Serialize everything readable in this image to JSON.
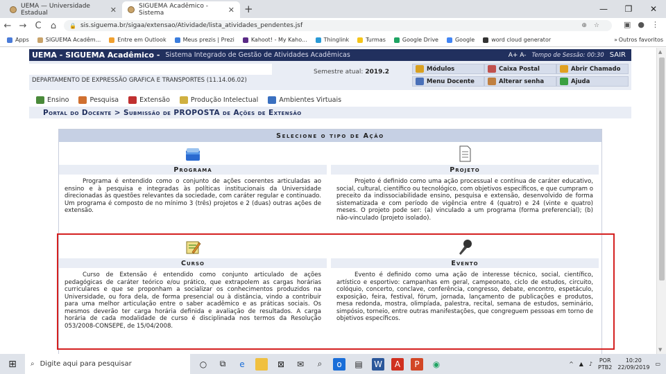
{
  "browser": {
    "tabs": [
      {
        "label": "UEMA — Universidade Estadual",
        "active": false
      },
      {
        "label": "SIGUEMA Acadêmico - Sistema",
        "active": true
      }
    ],
    "new_tab": "+",
    "window_controls": [
      "—",
      "❐",
      "✕"
    ],
    "url": "sis.siguema.br/sigaa/extensao/Atividade/lista_atividades_pendentes.jsf",
    "bookmarks": [
      {
        "label": "Apps",
        "color": "#4a7bd8"
      },
      {
        "label": "SIGUEMA Acadêm...",
        "color": "#c9a36a"
      },
      {
        "label": "Entre em Outlook",
        "color": "#f0a030"
      },
      {
        "label": "Meus prezis | Prezi",
        "color": "#3b7ddd"
      },
      {
        "label": "Kahoot! - My Kaho...",
        "color": "#5a2a86"
      },
      {
        "label": "Thinglink",
        "color": "#2a9ad6"
      },
      {
        "label": "Turmas",
        "color": "#f5c51a"
      },
      {
        "label": "Google Drive",
        "color": "#1fa463"
      },
      {
        "label": "Google",
        "color": "#4285f4"
      },
      {
        "label": "word cloud generator",
        "color": "#333333"
      }
    ],
    "bookmarks_more": "»",
    "bookmarks_other": "Outros favoritos"
  },
  "header": {
    "system_name": "UEMA - SIGUEMA Acadêmico -",
    "subtitle": "Sistema Integrado de Gestão de Atividades Acadêmicas",
    "font_controls": "A+  A-",
    "session": "Tempo de Sessão: 00:30",
    "logout": "SAIR"
  },
  "info": {
    "department": "DEPARTAMENTO DE EXPRESSÃO GRAFICA E TRANSPORTES (11.14.06.02)",
    "semester_label": "Semestre atual:",
    "semester_value": "2019.2",
    "links": [
      {
        "label": "Módulos",
        "color": "#d9a020"
      },
      {
        "label": "Caixa Postal",
        "color": "#c0504d"
      },
      {
        "label": "Abrir Chamado",
        "color": "#e0a020"
      },
      {
        "label": "Menu Docente",
        "color": "#4a70b8"
      },
      {
        "label": "Alterar senha",
        "color": "#c08040"
      },
      {
        "label": "Ajuda",
        "color": "#3aa040"
      }
    ]
  },
  "modules": [
    {
      "label": "Ensino",
      "color": "#4a8a3a"
    },
    {
      "label": "Pesquisa",
      "color": "#d07030"
    },
    {
      "label": "Extensão",
      "color": "#c03030"
    },
    {
      "label": "Produção Intelectual",
      "color": "#d0b040"
    },
    {
      "label": "Ambientes Virtuais",
      "color": "#3a70c0"
    }
  ],
  "breadcrumb": "Portal do Docente > Submissão de PROPOSTA de Ações de Extensão",
  "panel": {
    "heading": "Selecione o tipo de Ação",
    "actions": [
      {
        "title": "Programa",
        "icon": "folder-icon",
        "description": "Programa é entendido como o conjunto de ações coerentes articuladas ao ensino e à pesquisa e integradas às políticas institucionais da Universidade direcionadas às questões relevantes da sociedade, com caráter regular e continuado. Um programa é composto de no mínimo 3 (três) projetos e 2 (duas) outras ações de extensão."
      },
      {
        "title": "Projeto",
        "icon": "document-icon",
        "description": "Projeto é definido como uma ação processual e contínua de caráter educativo, social, cultural, científico ou tecnológico, com objetivos específicos, e que cumpram o preceito da indissociabilidade ensino, pesquisa e extensão, desenvolvido de forma sistematizada e com período de vigência entre 4 (quatro) e 24 (vinte e quatro) meses. O projeto pode ser: (a) vinculado a um programa (forma preferencial); (b) não-vinculado (projeto isolado)."
      },
      {
        "title": "Curso",
        "icon": "notepad-pencil-icon",
        "description": "Curso de Extensão é entendido como conjunto articulado de ações pedagógicas de caráter teórico e/ou prático, que extrapolem as cargas horárias curriculares e que se proponham a socializar os conhecimentos produzidos na Universidade, ou fora dela, de forma presencial ou à distância, vindo a contribuir para uma melhor articulação entre o saber acadêmico e as práticas sociais. Os mesmos deverão ter carga horária definida e avaliação de resultados. A carga horária de cada modalidade de curso é disciplinada nos termos da Resolução 053/2008-CONSEPE, de 15/04/2008."
      },
      {
        "title": "Evento",
        "icon": "microphone-icon",
        "description": "Evento é definido como uma ação de interesse técnico, social, científico, artístico e esportivo: campanhas em geral, campeonato, ciclo de estudos, circuito, colóquio, concerto, conclave, conferência, congresso, debate, encontro, espetáculo, exposição, feira, festival, fórum, jornada, lançamento de publicações e produtos, mesa redonda, mostra, olimpíada, palestra, recital, semana de estudos, seminário, simpósio, torneio, entre outras manifestações, que congreguem pessoas em torno de objetivos específicos."
      }
    ]
  },
  "taskbar": {
    "search_placeholder": "Digite aqui para pesquisar",
    "lang_top": "POR",
    "lang_bottom": "PTB2",
    "time": "10:20",
    "date": "22/09/2019"
  },
  "colors": {
    "header_bg": "#21305e",
    "highlight": "#d42020"
  }
}
